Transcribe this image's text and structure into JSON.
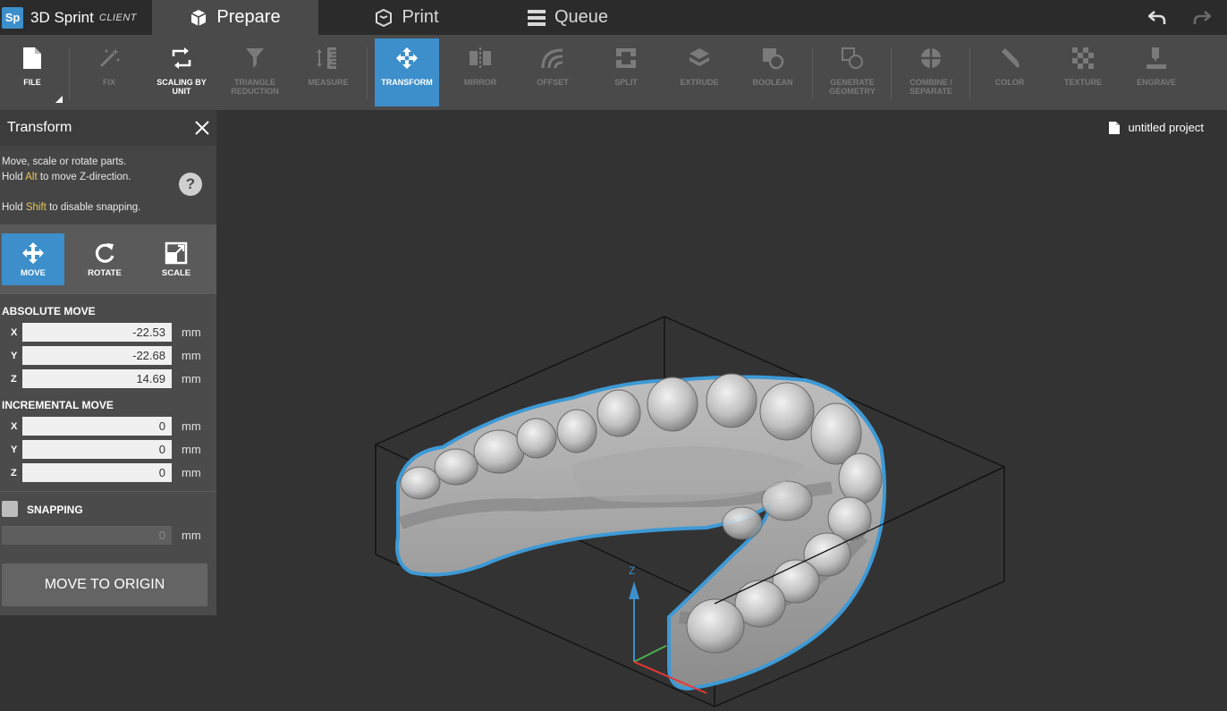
{
  "app": {
    "badge": "Sp",
    "name": "3D Sprint",
    "edition": "CLIENT"
  },
  "tabs": [
    {
      "label": "Prepare",
      "icon": "cube-icon",
      "active": true
    },
    {
      "label": "Print",
      "icon": "printer-icon",
      "active": false
    },
    {
      "label": "Queue",
      "icon": "list-icon",
      "active": false
    }
  ],
  "toolbar": {
    "file": "FILE",
    "fix": "FIX",
    "scaling": "SCALING BY UNIT",
    "triangle": "TRIANGLE REDUCTION",
    "measure": "MEASURE",
    "transform": "TRANSFORM",
    "mirror": "MIRROR",
    "offset": "OFFSET",
    "split": "SPLIT",
    "extrude": "EXTRUDE",
    "boolean": "BOOLEAN",
    "generate": "GENERATE GEOMETRY",
    "combine": "COMBINE / SEPARATE",
    "color": "COLOR",
    "texture": "TEXTURE",
    "engrave": "ENGRAVE"
  },
  "project": {
    "name": "untitled project"
  },
  "panel": {
    "title": "Transform",
    "help_line1": "Move, scale or rotate parts.",
    "help_line2_pre": "Hold ",
    "help_line2_key": "Alt",
    "help_line2_post": " to move Z-direction.",
    "help_line3_pre": "Hold ",
    "help_line3_key": "Shift",
    "help_line3_post": " to disable snapping.",
    "help_q": "?",
    "modes": {
      "move": "MOVE",
      "rotate": "ROTATE",
      "scale": "SCALE"
    },
    "absolute_title": "ABSOLUTE MOVE",
    "absolute": {
      "x": "-22.53",
      "y": "-22.68",
      "z": "14.69"
    },
    "incremental_title": "INCREMENTAL MOVE",
    "incremental": {
      "x": "0",
      "y": "0",
      "z": "0"
    },
    "axis": {
      "x": "X",
      "y": "Y",
      "z": "Z"
    },
    "unit": "mm",
    "snapping_label": "SNAPPING",
    "snapping_value": "0",
    "move_origin": "MOVE TO ORIGIN"
  },
  "viewport": {
    "axis_z": "Z"
  }
}
